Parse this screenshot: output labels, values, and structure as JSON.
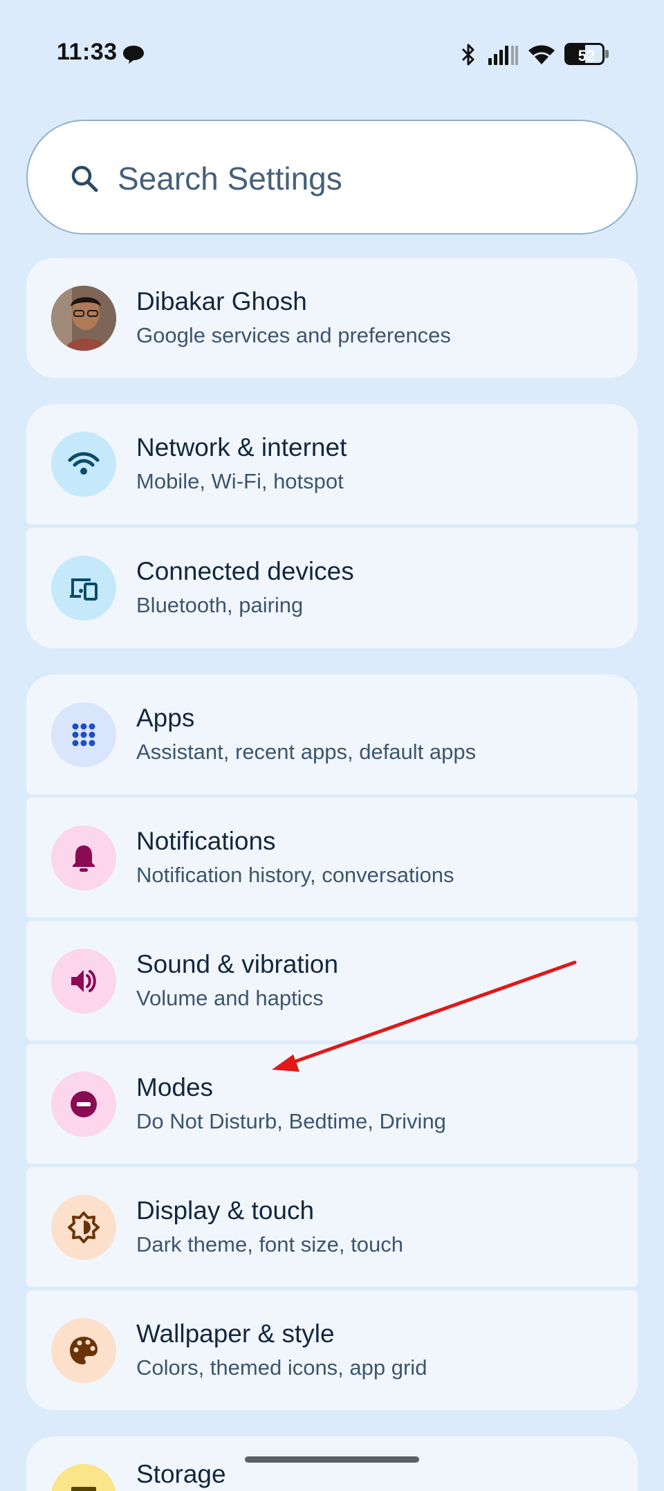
{
  "status_bar": {
    "time": "11:33",
    "battery_level": "52",
    "icons": [
      "chat-bubble-icon",
      "bluetooth-icon",
      "signal-icon",
      "wifi-icon",
      "battery-icon"
    ]
  },
  "search": {
    "placeholder": "Search Settings"
  },
  "account": {
    "name": "Dibakar Ghosh",
    "subtitle": "Google services and preferences"
  },
  "settings_items": [
    {
      "title": "Network & internet",
      "subtitle": "Mobile, Wi-Fi, hotspot",
      "icon": "wifi-icon",
      "icon_bg": "#c5e9fb",
      "icon_color": "#0b4b6b"
    },
    {
      "title": "Connected devices",
      "subtitle": "Bluetooth, pairing",
      "icon": "devices-icon",
      "icon_bg": "#c5e9fb",
      "icon_color": "#0b4b6b"
    },
    {
      "title": "Apps",
      "subtitle": "Assistant, recent apps, default apps",
      "icon": "apps-grid-icon",
      "icon_bg": "#d8e5fb",
      "icon_color": "#1c4fc2"
    },
    {
      "title": "Notifications",
      "subtitle": "Notification history, conversations",
      "icon": "bell-icon",
      "icon_bg": "#fbd6ec",
      "icon_color": "#8a0a54"
    },
    {
      "title": "Sound & vibration",
      "subtitle": "Volume and haptics",
      "icon": "speaker-icon",
      "icon_bg": "#fbd6ec",
      "icon_color": "#8a0a54"
    },
    {
      "title": "Modes",
      "subtitle": "Do Not Disturb, Bedtime, Driving",
      "icon": "do-not-disturb-icon",
      "icon_bg": "#fbd6ec",
      "icon_color": "#8a0a54"
    },
    {
      "title": "Display & touch",
      "subtitle": "Dark theme, font size, touch",
      "icon": "brightness-icon",
      "icon_bg": "#fde0cc",
      "icon_color": "#6b3408"
    },
    {
      "title": "Wallpaper & style",
      "subtitle": "Colors, themed icons, app grid",
      "icon": "palette-icon",
      "icon_bg": "#fde0cc",
      "icon_color": "#6b3408"
    },
    {
      "title": "Storage",
      "subtitle": "",
      "icon": "storage-icon",
      "icon_bg": "#fbe58a",
      "icon_color": "#5a4500"
    }
  ],
  "annotation": {
    "arrow_color": "#e01818"
  }
}
